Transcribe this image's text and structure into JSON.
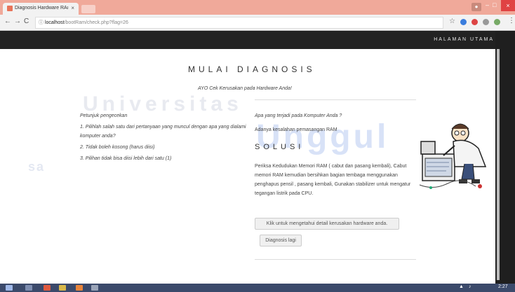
{
  "browser": {
    "tab_title": "Diagnosis Hardware RAı",
    "tab_close": "×",
    "url_host": "localhost",
    "url_path": "/bootRam/check.php?flag=26",
    "nav_back": "←",
    "nav_forward": "→",
    "nav_reload": "C",
    "info_icon": "ⓘ",
    "star_icon": "☆",
    "menu_icon": "⋮",
    "window_min": "–",
    "window_max": "□",
    "window_close": "×"
  },
  "site": {
    "nav_home": "HALAMAN UTAMA"
  },
  "watermark": {
    "w1": "Universitas",
    "w2": "Unggul",
    "w3": "sa"
  },
  "page": {
    "title": "MULAI DIAGNOSIS",
    "subtitle": "AYO Cek Kerusakan pada Hardware Anda!",
    "instructions": {
      "heading": "Petunjuk pengecekan",
      "items": [
        "1. Pilihlah salah satu dari pertanyaan yang muncul dengan apa yang dialami komputer anda?",
        "2. Tidak boleh kosong (harus diisi)",
        "3. Pilihan tidak bisa diisi lebih dari satu (1)"
      ]
    },
    "question": "Apa yang terjadi pada Komputer Anda ?",
    "answer": "Adanya kesalahan pemasangan RAM",
    "solution_heading": "SOLUSI",
    "solution_text": "Periksa Kedudukan Memori RAM ( cabut dan pasang kembali), Cabut memori RAM kemudian bersihkan bagian tembaga menggunakan penghapus pensil , pasang kembali, Gunakan stabilizer untuk mengatur tegangan listrik pada CPU.",
    "detail_button": "Klik untuk mengetahui detail kerusakan hardware anda.",
    "retry_button": "Diagnosis lagi"
  },
  "taskbar": {
    "clock": "2:27"
  },
  "colors": {
    "tabbar": "#f0a99a",
    "header": "#222222",
    "taskbar": "#3b4a6b"
  }
}
